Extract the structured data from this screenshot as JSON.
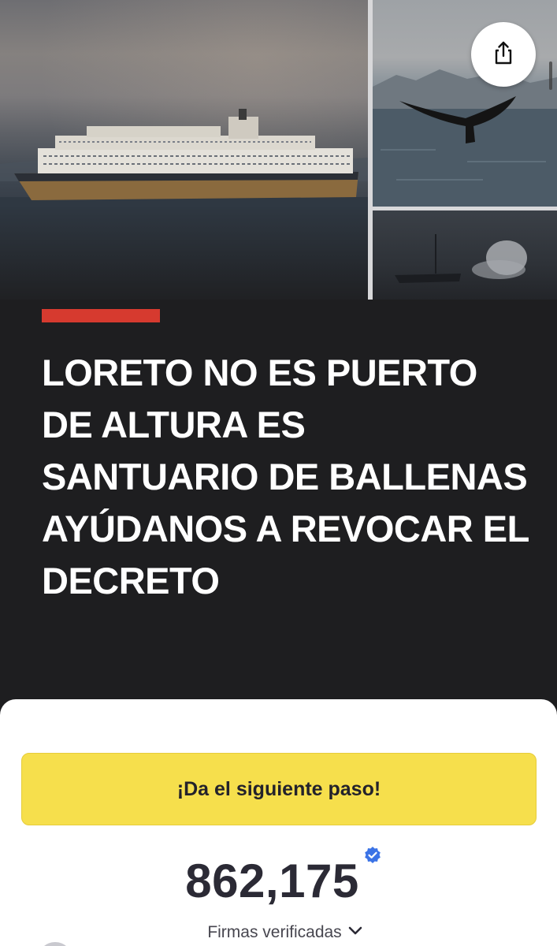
{
  "hero": {
    "images": [
      {
        "icon": "cruise-ship-photo"
      },
      {
        "icon": "whale-tail-photo"
      },
      {
        "icon": "whale-spout-photo"
      }
    ],
    "share_icon": "share-icon"
  },
  "petition": {
    "title": "LORETO NO ES PUERTO DE ALTURA ES SANTUARIO DE BALLENAS AYÚDANOS A REVOCAR EL DECRETO",
    "accent_color": "#d63a2f"
  },
  "card": {
    "cta_label": "¡Da el siguiente paso!",
    "cta_color": "#f6df4c",
    "signature_count": "862,175",
    "verified_icon": "verified-badge-icon",
    "verified_color": "#3b73e6",
    "signatures_caption": "Firmas verificadas",
    "expand_icon": "chevron-down-icon"
  }
}
